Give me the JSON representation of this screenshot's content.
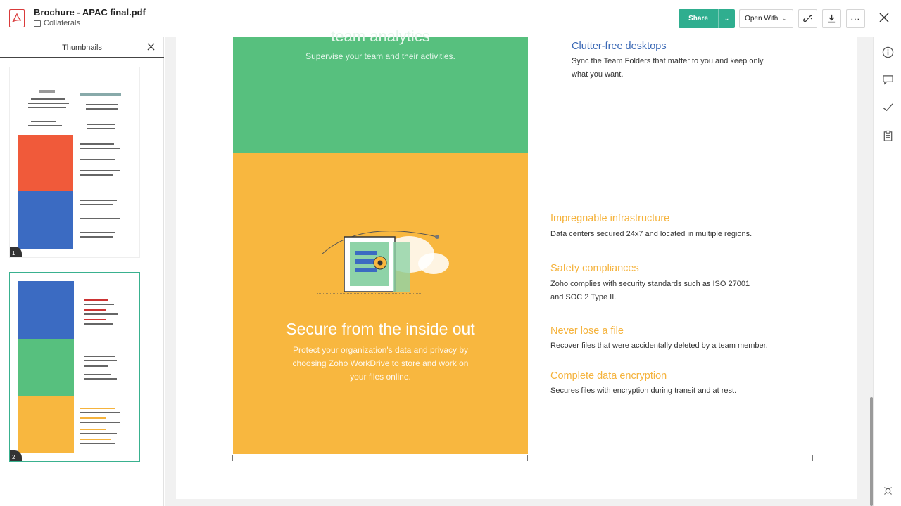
{
  "header": {
    "file_name": "Brochure - APAC final.pdf",
    "folder": "Collaterals",
    "share_label": "Share",
    "open_with_label": "Open With"
  },
  "thumbnails": {
    "title": "Thumbnails",
    "pages": [
      {
        "number": "1"
      },
      {
        "number": "2"
      }
    ]
  },
  "document": {
    "green_heading": "team analytics",
    "green_subtitle": "Supervise your team and their activities.",
    "hero_title": "Secure from the inside out",
    "hero_description": "Protect your organization's data and privacy by choosing Zoho WorkDrive to store and work on your files online.",
    "top_feature": {
      "title": "Clutter-free desktops",
      "description": "Sync the Team Folders that matter to you and keep only what you want.",
      "color": "#3a68b5"
    },
    "features": [
      {
        "title": "Impregnable infrastructure",
        "description": "Data centers secured 24x7 and located in multiple regions."
      },
      {
        "title": "Safety compliances",
        "description": "Zoho complies with security standards such as ISO 27001 and SOC 2 Type II."
      },
      {
        "title": "Never lose a file",
        "description": "Recover files that were accidentally deleted by a team member."
      },
      {
        "title": "Complete data encryption",
        "description": "Secures files with encryption during transit and at rest."
      }
    ],
    "feature_color": "#f5b33d"
  },
  "colors": {
    "accent": "#2fae8f",
    "green_panel": "#57c07e",
    "yellow_panel": "#f8b73f"
  }
}
